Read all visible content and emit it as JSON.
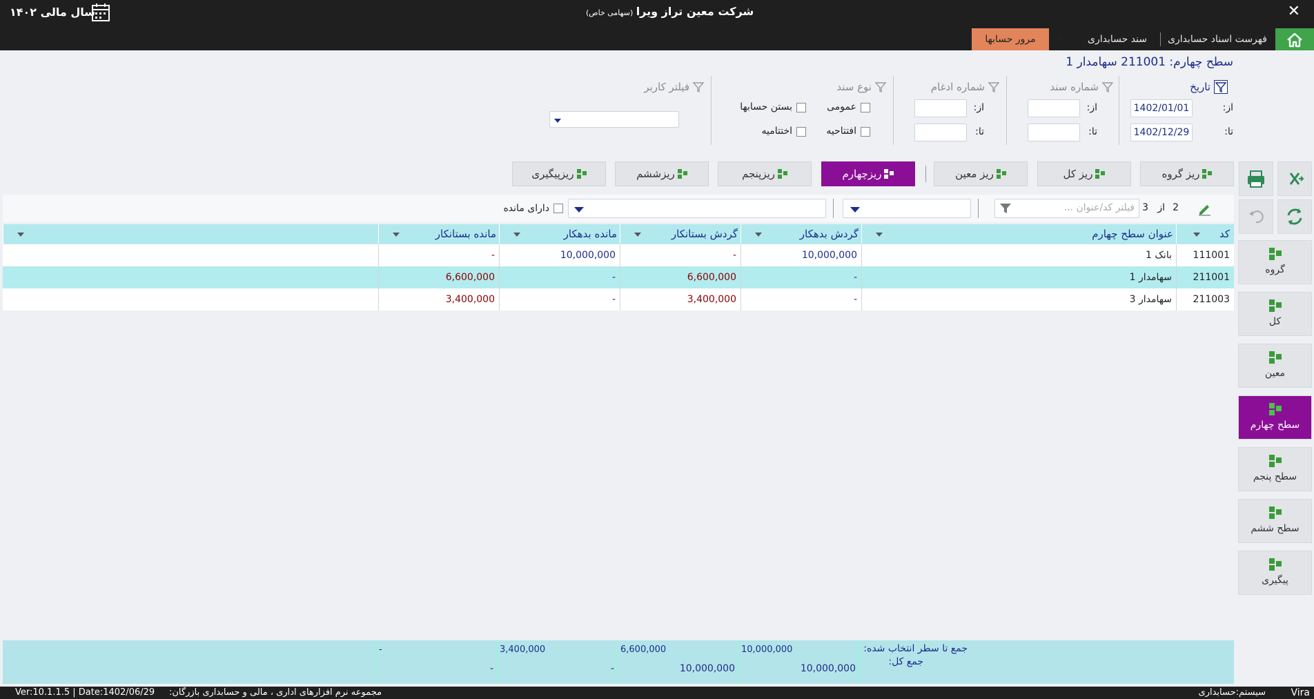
{
  "window": {
    "fiscal_year": "سال مالی ۱۴۰۲",
    "company": "شرکت معین تراز ویرا",
    "company_type": "(سهامی خاص)",
    "close": "✕"
  },
  "tabs": [
    {
      "label": "فهرست اسناد حسابداری"
    },
    {
      "label": "سند حسابداری"
    },
    {
      "label": "مرور حسابها"
    }
  ],
  "page_title": "سطح چهارم: 211001 سهامدار 1",
  "filters": {
    "date": {
      "label": "تاریخ",
      "from_label": "از:",
      "to_label": "تا:",
      "from": "1402/01/01",
      "to": "1402/12/29"
    },
    "doc_number": {
      "label": "شماره سند",
      "from_label": "از:",
      "to_label": "تا:"
    },
    "merge_number": {
      "label": "شماره ادغام",
      "from_label": "از:",
      "to_label": "تا:"
    },
    "doc_type": {
      "label": "نوع سند",
      "general": "عمومی",
      "closing_accounts": "بستن حسابها",
      "opening": "افتتاحیه",
      "closing": "اختتامیه"
    },
    "user_filter": {
      "label": "فیلتر کاربر"
    }
  },
  "subtabs": [
    {
      "label": "ریز گروه"
    },
    {
      "label": "ریز کل"
    },
    {
      "label": "ریز معین"
    },
    {
      "label": "ریزچهارم"
    },
    {
      "label": "ریزپنجم"
    },
    {
      "label": "ریزششم"
    },
    {
      "label": "ریزپیگیری"
    }
  ],
  "toolbar": {
    "page_current": "2",
    "page_of": "از",
    "page_total": "3",
    "search_placeholder": "فیلتر کد/عنوان ...",
    "has_balance": "دارای مانده"
  },
  "table": {
    "headers": [
      "کد",
      "عنوان سطح چهارم",
      "گردش بدهکار",
      "گردش بستانکار",
      "مانده بدهکار",
      "مانده بستانکار"
    ],
    "rows": [
      {
        "code": "111001",
        "title": "بانک 1",
        "debit_turnover": "10,000,000",
        "credit_turnover": "-",
        "debit_balance": "10,000,000",
        "credit_balance": "-"
      },
      {
        "code": "211001",
        "title": "سهامدار 1",
        "debit_turnover": "-",
        "credit_turnover": "6,600,000",
        "debit_balance": "-",
        "credit_balance": "6,600,000"
      },
      {
        "code": "211003",
        "title": "سهامدار 3",
        "debit_turnover": "-",
        "credit_turnover": "3,400,000",
        "debit_balance": "-",
        "credit_balance": "3,400,000"
      }
    ]
  },
  "totals": {
    "selected_label": "جمع تا سطر انتخاب شده:",
    "total_label": "جمع کل:",
    "selected": {
      "debit_turnover": "10,000,000",
      "credit_turnover": "6,600,000",
      "debit_balance": "3,400,000",
      "credit_balance": "-"
    },
    "total": {
      "debit_turnover": "10,000,000",
      "credit_turnover": "10,000,000",
      "debit_balance": "-",
      "credit_balance": "-"
    }
  },
  "side_buttons": [
    {
      "label": "گروه"
    },
    {
      "label": "کل"
    },
    {
      "label": "معین"
    },
    {
      "label": "سطح چهارم"
    },
    {
      "label": "سطح پنجم"
    },
    {
      "label": "سطح ششم"
    },
    {
      "label": "پیگیری"
    }
  ],
  "status": {
    "app": "Vira",
    "system": "سیستم:حسابداری",
    "suite": "مجموعه نرم افزارهای اداری ، مالی و حسابداری بازرگان:",
    "version": "Ver:10.1.1.5 | Date:1402/06/29"
  },
  "colors": {
    "accent": "#8a0f96",
    "header_bg": "#1f1f1f",
    "selected_row": "#b3ecef",
    "active_tab": "#e2855a",
    "home": "#3fa44a"
  }
}
